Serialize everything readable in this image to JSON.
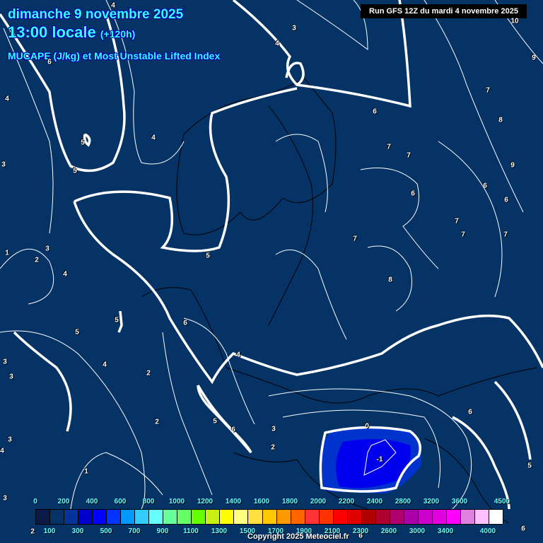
{
  "header": {
    "date": "dimanche 9 novembre 2025",
    "time": "13:00 locale",
    "lead": "(+120h)",
    "parameter": "MUCAPE (J/kg) et Most Unstable Lifted Index",
    "run": "Run GFS 12Z du mardi 4 novembre 2025"
  },
  "contour_labels": [
    "4",
    "3",
    "10",
    "4",
    "9",
    "6",
    "4",
    "7",
    "6",
    "8",
    "5",
    "4",
    "5",
    "7",
    "7",
    "9",
    "3",
    "6",
    "6",
    "6",
    "7",
    "7",
    "7",
    "7",
    "5",
    "3",
    "1",
    "2",
    "4",
    "8",
    "5",
    "6",
    "5",
    "4",
    "4",
    "2",
    "3",
    "3",
    "6",
    "2",
    "5",
    "6",
    "3",
    "0",
    "3",
    "2",
    "4",
    "-1",
    "5",
    "1",
    "3",
    "6",
    "6",
    "2"
  ],
  "legend": {
    "top_labels": [
      "0",
      "200",
      "400",
      "600",
      "800",
      "1000",
      "1200",
      "1400",
      "1600",
      "1800",
      "2000",
      "2200",
      "2400",
      "2800",
      "3200",
      "3600",
      "4500"
    ],
    "bottom_labels": [
      "100",
      "300",
      "500",
      "700",
      "900",
      "1100",
      "1300",
      "1500",
      "1700",
      "1900",
      "2100",
      "2300",
      "2600",
      "3000",
      "3400",
      "4000"
    ],
    "colors": [
      "#0c1a48",
      "#053366",
      "#053399",
      "#0000cc",
      "#0000ff",
      "#0033ff",
      "#0099ff",
      "#33ccff",
      "#66ffff",
      "#66ff99",
      "#66ff66",
      "#66ff00",
      "#c8f010",
      "#ffff00",
      "#ffff80",
      "#ffe040",
      "#ffc800",
      "#ff9900",
      "#ff6600",
      "#ff3333",
      "#ff3300",
      "#ff0000",
      "#e00000",
      "#b00000",
      "#b00030",
      "#b00070",
      "#aa00aa",
      "#cc00cc",
      "#e000e0",
      "#ff00ff",
      "#e080e0",
      "#ffc0ff",
      "#ffffff"
    ]
  },
  "footer": {
    "copyright": "Copyright 2025 Meteociel.fr"
  }
}
